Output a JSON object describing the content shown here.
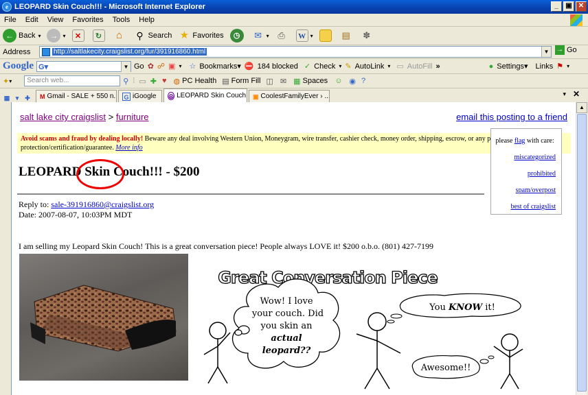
{
  "window": {
    "title": "LEOPARD Skin Couch!!! - Microsoft Internet Explorer",
    "min": "_",
    "max": "▣",
    "close": "✕"
  },
  "menu": [
    "File",
    "Edit",
    "View",
    "Favorites",
    "Tools",
    "Help"
  ],
  "toolbar": {
    "back": "Back",
    "search": "Search",
    "favorites": "Favorites"
  },
  "address": {
    "label": "Address",
    "url": "http://saltlakecity.craigslist.org/fur/391916860.html",
    "go": "Go"
  },
  "googlebar": {
    "logo": "Google",
    "go": "Go",
    "bookmarks": "Bookmarks▾",
    "blocked": "184 blocked",
    "check": "Check",
    "autolink": "AutoLink",
    "autofill": "AutoFill",
    "settings": "Settings▾",
    "links": "Links"
  },
  "row4": {
    "search_placeholder": "Search web...",
    "pchealth": "PC Health",
    "formfill": "Form Fill",
    "spaces": "Spaces"
  },
  "tabs": [
    {
      "label": "Gmail - SALE + 550 n..."
    },
    {
      "label": "iGoogle"
    },
    {
      "label": "LEOPARD Skin Couch!!..."
    },
    {
      "label": "CoolestFamilyEver › ..."
    }
  ],
  "page": {
    "breadcrumb_site": "salt lake city craigslist",
    "breadcrumb_sep": ">",
    "breadcrumb_cat": "furniture",
    "email_link": "email this posting to a friend",
    "warning_bold": "Avoid scams and fraud by dealing locally!",
    "warning_text": " Beware any deal involving Western Union, Moneygram, wire transfer, cashier check, money order, shipping, escrow, or any promise of transaction protection/certification/guarantee.",
    "warning_more": "More info",
    "flag_pre": "please",
    "flag_link": "flag",
    "flag_post": "with care:",
    "flag_items": [
      "miscategorized",
      "prohibited",
      "spam/overpost",
      "best of craigslist"
    ],
    "title": "LEOPARD Skin Couch!!! - $200",
    "reply_label": "Reply to:",
    "reply_email": "sale-391916860@craigslist.org",
    "date": "Date: 2007-08-07, 10:03PM MDT",
    "body": "I am selling my Leopard Skin Couch! This is a great conversation piece! People always LOVE it! $200 o.b.o. (801) 427-7199"
  },
  "comic": {
    "title": "Great Conversation Piece",
    "bubble1_lines": [
      "Wow! I love",
      "your couch. Did",
      "you skin an"
    ],
    "bubble1_bold": "actual",
    "bubble1_end": "leopard??",
    "bubble2_pre": "You",
    "bubble2_em": "KNOW",
    "bubble2_post": "it!",
    "bubble3": "Awesome!!"
  }
}
